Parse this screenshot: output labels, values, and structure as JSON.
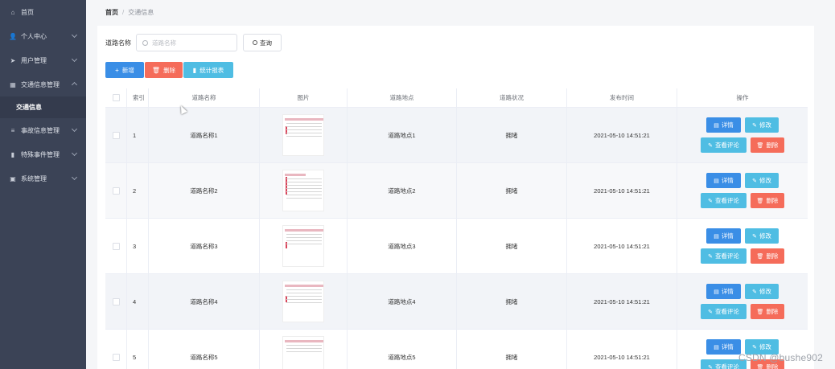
{
  "sidebar": {
    "items": [
      {
        "label": "首页",
        "icon": "home-icon"
      },
      {
        "label": "个人中心",
        "icon": "user-icon"
      },
      {
        "label": "用户管理",
        "icon": "send-icon"
      },
      {
        "label": "交通信息管理",
        "icon": "grid-icon"
      },
      {
        "label": "交通信息",
        "icon": ""
      },
      {
        "label": "事故信息管理",
        "icon": "list-icon"
      },
      {
        "label": "特殊事件管理",
        "icon": "bar-chart-icon"
      },
      {
        "label": "系统管理",
        "icon": "settings-box-icon"
      }
    ]
  },
  "breadcrumb": {
    "home": "首页",
    "separator": "/",
    "current": "交通信息"
  },
  "search": {
    "label": "道路名称",
    "placeholder": "道路名称",
    "value": "",
    "button": "查询"
  },
  "actions": {
    "add": "新增",
    "delete": "删除",
    "report": "统计报表"
  },
  "table": {
    "headers": [
      "索引",
      "道路名称",
      "图片",
      "道路地点",
      "道路状况",
      "发布时间",
      "操作"
    ],
    "rows": [
      {
        "index": "1",
        "name": "道路名称1",
        "place": "道路地点1",
        "status": "拥堵",
        "time": "2021-05-10 14:51:21"
      },
      {
        "index": "2",
        "name": "道路名称2",
        "place": "道路地点2",
        "status": "拥堵",
        "time": "2021-05-10 14:51:21"
      },
      {
        "index": "3",
        "name": "道路名称3",
        "place": "道路地点3",
        "status": "拥堵",
        "time": "2021-05-10 14:51:21"
      },
      {
        "index": "4",
        "name": "道路名称4",
        "place": "道路地点4",
        "status": "拥堵",
        "time": "2021-05-10 14:51:21"
      },
      {
        "index": "5",
        "name": "道路名称5",
        "place": "道路地点5",
        "status": "拥堵",
        "time": "2021-05-10 14:51:21"
      }
    ],
    "ops": {
      "detail": "详情",
      "edit": "修改",
      "review": "查看评论",
      "remove": "删除"
    }
  },
  "watermark": "CSDN @bushe902",
  "colors": {
    "sidebar": "#3b4356",
    "primary": "#3a8ee6",
    "danger": "#f56c5a",
    "info": "#4fbde3"
  }
}
